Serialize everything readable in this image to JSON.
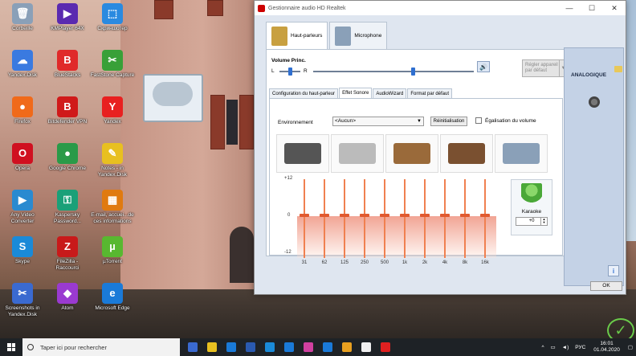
{
  "desktop": {
    "icons": [
      {
        "label": "Corbeille",
        "glyph": "🗑",
        "color": "#8aa0b8"
      },
      {
        "label": "KMPlayer 64X",
        "glyph": "▶",
        "color": "#5a2ab0"
      },
      {
        "label": "Скриншотер",
        "glyph": "⬚",
        "color": "#2a8ae0"
      },
      {
        "label": "Yandex.Disk",
        "glyph": "☁",
        "color": "#3a7ae0"
      },
      {
        "label": "BlueStacks",
        "glyph": "B",
        "color": "#e02a2a"
      },
      {
        "label": "FastStone Capture",
        "glyph": "✂",
        "color": "#38a038"
      },
      {
        "label": "Firefox",
        "glyph": "●",
        "color": "#f06a1a"
      },
      {
        "label": "Bitdefender VPN",
        "glyph": "B",
        "color": "#d01a1a"
      },
      {
        "label": "Yandex",
        "glyph": "Y",
        "color": "#e82020"
      },
      {
        "label": "Opera",
        "glyph": "O",
        "color": "#d01020"
      },
      {
        "label": "Google Chrome",
        "glyph": "●",
        "color": "#2a9a48"
      },
      {
        "label": "Notes - in Yandex.Disk",
        "glyph": "✎",
        "color": "#e8c020"
      },
      {
        "label": "Any Video Converter",
        "glyph": "▶",
        "color": "#2a8ad0"
      },
      {
        "label": "Kaspersky Password...",
        "glyph": "⚿",
        "color": "#1aa078"
      },
      {
        "label": "E-mail, accuei...de ces informations",
        "glyph": "▦",
        "color": "#e07a10"
      },
      {
        "label": "Skype",
        "glyph": "S",
        "color": "#1a8ad8"
      },
      {
        "label": "FileZilla - Raccourci",
        "glyph": "Z",
        "color": "#c81a1a"
      },
      {
        "label": "µTorrent",
        "glyph": "µ",
        "color": "#58b830"
      },
      {
        "label": "Screenshots in Yandex.Disk",
        "glyph": "✂",
        "color": "#3a6ad0"
      },
      {
        "label": "Atom",
        "glyph": "◆",
        "color": "#9a3ad0"
      },
      {
        "label": "Microsoft Edge",
        "glyph": "e",
        "color": "#1a7ad8"
      }
    ]
  },
  "dialog": {
    "title": "Gestionnaire audio HD Realtek",
    "controls": {
      "minimize": "—",
      "maximize": "☐",
      "close": "✕"
    },
    "main_tabs": [
      {
        "label": "Haut-parleurs",
        "color": "#c8a040"
      },
      {
        "label": "Microphone",
        "color": "#8aa0b8"
      }
    ],
    "volume": {
      "label": "Volume Princ.",
      "left": "L",
      "right": "R",
      "speaker_glyph": "🔊",
      "default_button": "Régler appareil par défaut",
      "level": 0.62,
      "balance": 0.5
    },
    "sub_tabs": [
      "Configuration du haut-parleur",
      "Effet Sonore",
      "AudioWizard",
      "Format par défaut"
    ],
    "environment": {
      "label": "Environnement",
      "value": "<Aucun>",
      "reset_label": "Réinitialisation",
      "equalizer_label": "Égalisation du volume"
    },
    "presets": [
      {
        "name": "stone-preset",
        "color": "#555"
      },
      {
        "name": "bathroom-preset",
        "color": "#bbb"
      },
      {
        "name": "colosseum-preset",
        "color": "#9a6a3a"
      },
      {
        "name": "arena-preset",
        "color": "#7a5030"
      },
      {
        "name": "opera-house-preset",
        "color": "#8aa0b8"
      }
    ],
    "equalizer": {
      "db_top": "+12",
      "db_mid": "0",
      "db_bottom": "-12",
      "bands": [
        "31",
        "62",
        "125",
        "250",
        "500",
        "1k",
        "2k",
        "4k",
        "8k",
        "16k"
      ]
    },
    "karaoke": {
      "label": "Karaoke",
      "value": "+0"
    },
    "side": {
      "title": "ANALOGIQUE"
    },
    "info_glyph": "i",
    "ok_label": "OK"
  },
  "taskbar": {
    "search_placeholder": "Taper ici pour rechercher",
    "apps": [
      "#3a6ad0",
      "#e8c020",
      "#1a7ad8",
      "#2a5ab0",
      "#1a8ad8",
      "#1a7ad8",
      "#d040a0",
      "#1a7ad8",
      "#e8a020",
      "#f0f0f0",
      "#e02020"
    ],
    "tray": {
      "lang": "РУС",
      "time": "16:01",
      "date": "01.04.2020"
    }
  }
}
